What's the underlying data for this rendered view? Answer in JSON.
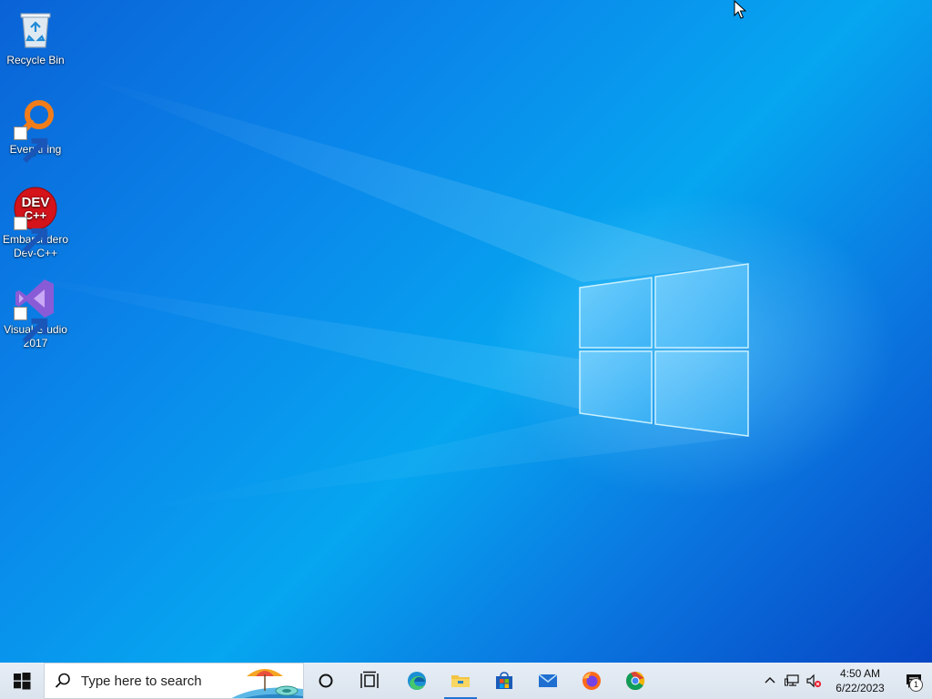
{
  "desktop": {
    "icons": [
      {
        "label": "Recycle Bin",
        "icon": "recycle-bin-icon"
      },
      {
        "label": "Everything",
        "icon": "everything-search-icon"
      },
      {
        "label": "Embarcadero Dev-C++",
        "icon": "dev-cpp-icon",
        "icon_text_1": "DEV",
        "icon_text_2": "C++"
      },
      {
        "label": "Visual Studio 2017",
        "icon": "visual-studio-icon"
      }
    ]
  },
  "taskbar": {
    "search_placeholder": "Type here to search",
    "pinned": [
      {
        "name": "cortana",
        "icon": "cortana-icon"
      },
      {
        "name": "task-view",
        "icon": "task-view-icon"
      },
      {
        "name": "edge",
        "icon": "edge-icon"
      },
      {
        "name": "file-explorer",
        "icon": "folder-icon",
        "active": true
      },
      {
        "name": "microsoft-store",
        "icon": "store-icon"
      },
      {
        "name": "mail",
        "icon": "mail-icon"
      },
      {
        "name": "firefox",
        "icon": "firefox-icon"
      },
      {
        "name": "chrome",
        "icon": "chrome-icon"
      }
    ],
    "tray": {
      "time": "4:50 AM",
      "date": "6/22/2023",
      "notification_count": "1"
    }
  },
  "colors": {
    "accent": "#1f73d3",
    "taskbar_bg": "#dfe8f1",
    "desktop_blue": "#0a86ea"
  }
}
